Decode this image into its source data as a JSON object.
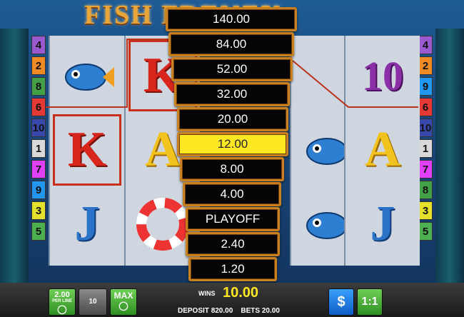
{
  "game": {
    "title": "FISH FRENZY"
  },
  "paylines_left": [
    "4",
    "2",
    "8",
    "6",
    "10",
    "1",
    "7",
    "9",
    "3",
    "5"
  ],
  "paylines_right": [
    "4",
    "2",
    "9",
    "6",
    "10",
    "1",
    "7",
    "8",
    "3",
    "5"
  ],
  "payline_colors": {
    "1": "#d9d9d9",
    "2": "#f08a24",
    "3": "#e3e12b",
    "4": "#9b59d0",
    "5": "#4caf50",
    "6": "#e53935",
    "7": "#e040fb",
    "8": "#43a047",
    "9": "#2196f3",
    "10": "#3949ab"
  },
  "reels": [
    [
      "fish",
      "K",
      "J"
    ],
    [
      "K",
      "A",
      "lifebuoy"
    ],
    [
      "",
      "",
      ""
    ],
    [
      "",
      "fish",
      "fish"
    ],
    [
      "10",
      "A",
      "J"
    ]
  ],
  "gamble_ladder": [
    "140.00",
    "84.00",
    "52.00",
    "32.00",
    "20.00",
    "12.00",
    "8.00",
    "4.00",
    "PLAYOFF",
    "2.40",
    "1.20"
  ],
  "gamble_active_index": 5,
  "bottom": {
    "bet_per_line": "2.00",
    "bet_per_line_label": "PER LINE",
    "lines": "10",
    "max_label": "MAX",
    "wins_label": "WINS",
    "wins_value": "10.00",
    "deposit_label": "DEPOSIT",
    "deposit_value": "820.00",
    "bets_label": "BETS",
    "bets_value": "20.00",
    "collect_icon": "$",
    "gamble_label": "1:1"
  }
}
